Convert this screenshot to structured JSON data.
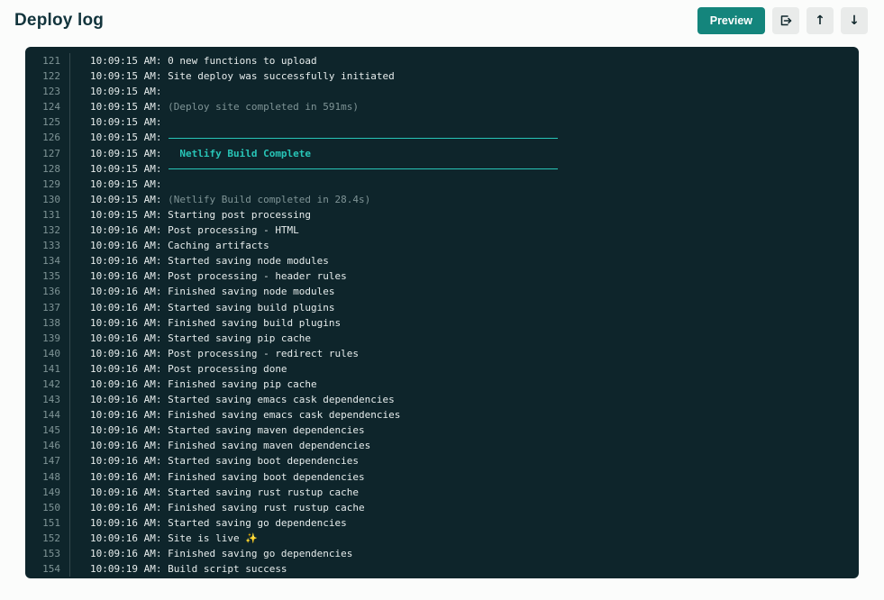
{
  "header": {
    "title": "Deploy log",
    "preview_label": "Preview",
    "copy_log_icon": "copy-log-icon",
    "up_icon": "↑",
    "down_icon": "↓"
  },
  "colors": {
    "accent_teal": "#14857c",
    "log_bg": "#0e252b",
    "log_text": "#e6ecec",
    "log_dim": "#7f9496",
    "log_teal": "#28c5b7"
  },
  "log": {
    "lines": [
      {
        "n": 121,
        "time": "10:09:15 AM:",
        "text": "0 new functions to upload",
        "style": "normal"
      },
      {
        "n": 122,
        "time": "10:09:15 AM:",
        "text": "Site deploy was successfully initiated",
        "style": "normal"
      },
      {
        "n": 123,
        "time": "10:09:15 AM:",
        "text": "",
        "style": "normal"
      },
      {
        "n": 124,
        "time": "10:09:15 AM:",
        "text": "(Deploy site completed in 591ms)",
        "style": "dim"
      },
      {
        "n": 125,
        "time": "10:09:15 AM:",
        "text": "",
        "style": "normal"
      },
      {
        "n": 126,
        "time": "10:09:15 AM:",
        "text": "",
        "style": "rule"
      },
      {
        "n": 127,
        "time": "10:09:15 AM:",
        "text": "  Netlify Build Complete",
        "style": "highlight"
      },
      {
        "n": 128,
        "time": "10:09:15 AM:",
        "text": "",
        "style": "rule"
      },
      {
        "n": 129,
        "time": "10:09:15 AM:",
        "text": "",
        "style": "normal"
      },
      {
        "n": 130,
        "time": "10:09:15 AM:",
        "text": "(Netlify Build completed in 28.4s)",
        "style": "dim"
      },
      {
        "n": 131,
        "time": "10:09:15 AM:",
        "text": "Starting post processing",
        "style": "normal"
      },
      {
        "n": 132,
        "time": "10:09:16 AM:",
        "text": "Post processing - HTML",
        "style": "normal"
      },
      {
        "n": 133,
        "time": "10:09:16 AM:",
        "text": "Caching artifacts",
        "style": "normal"
      },
      {
        "n": 134,
        "time": "10:09:16 AM:",
        "text": "Started saving node modules",
        "style": "normal"
      },
      {
        "n": 135,
        "time": "10:09:16 AM:",
        "text": "Post processing - header rules",
        "style": "normal"
      },
      {
        "n": 136,
        "time": "10:09:16 AM:",
        "text": "Finished saving node modules",
        "style": "normal"
      },
      {
        "n": 137,
        "time": "10:09:16 AM:",
        "text": "Started saving build plugins",
        "style": "normal"
      },
      {
        "n": 138,
        "time": "10:09:16 AM:",
        "text": "Finished saving build plugins",
        "style": "normal"
      },
      {
        "n": 139,
        "time": "10:09:16 AM:",
        "text": "Started saving pip cache",
        "style": "normal"
      },
      {
        "n": 140,
        "time": "10:09:16 AM:",
        "text": "Post processing - redirect rules",
        "style": "normal"
      },
      {
        "n": 141,
        "time": "10:09:16 AM:",
        "text": "Post processing done",
        "style": "normal"
      },
      {
        "n": 142,
        "time": "10:09:16 AM:",
        "text": "Finished saving pip cache",
        "style": "normal"
      },
      {
        "n": 143,
        "time": "10:09:16 AM:",
        "text": "Started saving emacs cask dependencies",
        "style": "normal"
      },
      {
        "n": 144,
        "time": "10:09:16 AM:",
        "text": "Finished saving emacs cask dependencies",
        "style": "normal"
      },
      {
        "n": 145,
        "time": "10:09:16 AM:",
        "text": "Started saving maven dependencies",
        "style": "normal"
      },
      {
        "n": 146,
        "time": "10:09:16 AM:",
        "text": "Finished saving maven dependencies",
        "style": "normal"
      },
      {
        "n": 147,
        "time": "10:09:16 AM:",
        "text": "Started saving boot dependencies",
        "style": "normal"
      },
      {
        "n": 148,
        "time": "10:09:16 AM:",
        "text": "Finished saving boot dependencies",
        "style": "normal"
      },
      {
        "n": 149,
        "time": "10:09:16 AM:",
        "text": "Started saving rust rustup cache",
        "style": "normal"
      },
      {
        "n": 150,
        "time": "10:09:16 AM:",
        "text": "Finished saving rust rustup cache",
        "style": "normal"
      },
      {
        "n": 151,
        "time": "10:09:16 AM:",
        "text": "Started saving go dependencies",
        "style": "normal"
      },
      {
        "n": 152,
        "time": "10:09:16 AM:",
        "text": "Site is live ✨",
        "style": "normal"
      },
      {
        "n": 153,
        "time": "10:09:16 AM:",
        "text": "Finished saving go dependencies",
        "style": "normal"
      },
      {
        "n": 154,
        "time": "10:09:19 AM:",
        "text": "Build script success",
        "style": "normal"
      }
    ]
  }
}
